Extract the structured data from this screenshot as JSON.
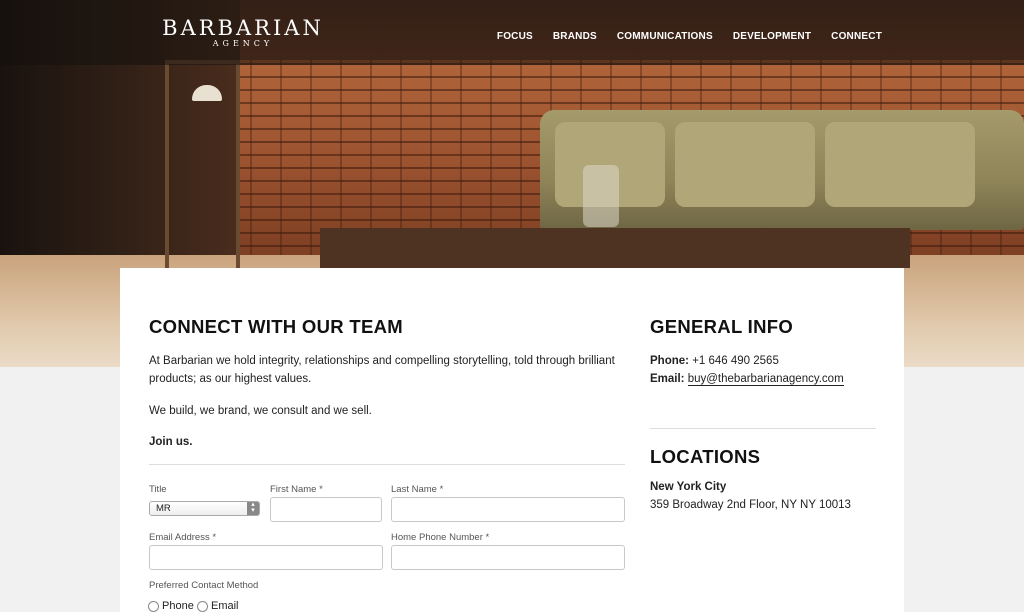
{
  "brand": {
    "name": "BARBARIAN",
    "tagline": "AGENCY"
  },
  "nav": [
    "FOCUS",
    "BRANDS",
    "COMMUNICATIONS",
    "DEVELOPMENT",
    "CONNECT"
  ],
  "connect": {
    "title": "CONNECT WITH OUR TEAM",
    "para1": "At Barbarian we hold integrity, relationships and compelling storytelling, told through brilliant products; as our highest values.",
    "para2": "We build, we brand, we consult and we sell.",
    "join": "Join us."
  },
  "form": {
    "title_label": "Title",
    "title_value": "MR",
    "first_name_label": "First Name *",
    "first_name_value": "",
    "last_name_label": "Last Name *",
    "last_name_value": "",
    "email_label": "Email Address *",
    "email_value": "",
    "phone_label": "Home Phone Number *",
    "phone_value": "",
    "contact_label": "Preferred Contact Method",
    "contact_options": [
      "Phone",
      "Email"
    ]
  },
  "general_info": {
    "title": "GENERAL INFO",
    "phone_label": "Phone:",
    "phone_value": "+1 646 490 2565",
    "email_label": "Email:",
    "email_value": "buy@thebarbarianagency.com"
  },
  "locations": {
    "title": "LOCATIONS",
    "city": "New York City",
    "address": "359 Broadway 2nd Floor, NY NY 10013"
  }
}
